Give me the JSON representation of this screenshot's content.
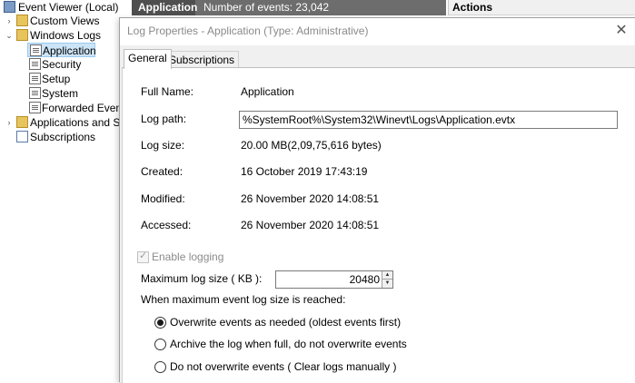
{
  "tree": {
    "root": "Event Viewer (Local)",
    "custom_views": "Custom Views",
    "windows_logs": "Windows Logs",
    "application": "Application",
    "security": "Security",
    "setup": "Setup",
    "system": "System",
    "forwarded": "Forwarded Events",
    "apps_services": "Applications and Ser",
    "subscriptions": "Subscriptions"
  },
  "topbar": {
    "log_name": "Application",
    "event_count": "Number of events: 23,042"
  },
  "actions": {
    "title": "Actions"
  },
  "dialog": {
    "title": "Log Properties - Application (Type: Administrative)",
    "close_glyph": "✕",
    "tabs": [
      "General",
      "Subscriptions"
    ],
    "general": {
      "full_name_label": "Full Name:",
      "full_name_value": "Application",
      "log_path_label": "Log path:",
      "log_path_value": "%SystemRoot%\\System32\\Winevt\\Logs\\Application.evtx",
      "log_size_label": "Log size:",
      "log_size_value": "20.00 MB(2,09,75,616 bytes)",
      "created_label": "Created:",
      "created_value": "16 October 2019 17:43:19",
      "modified_label": "Modified:",
      "modified_value": "26 November 2020 14:08:51",
      "accessed_label": "Accessed:",
      "accessed_value": "26 November 2020 14:08:51",
      "enable_logging_label": "Enable logging",
      "max_size_label": "Maximum log size ( KB ):",
      "max_size_value": "20480",
      "policy_label": "When maximum event log size is reached:",
      "options": [
        "Overwrite events as needed (oldest events first)",
        "Archive the log when full, do not overwrite events",
        "Do not overwrite events ( Clear logs manually )"
      ],
      "selected_option": 0
    }
  }
}
